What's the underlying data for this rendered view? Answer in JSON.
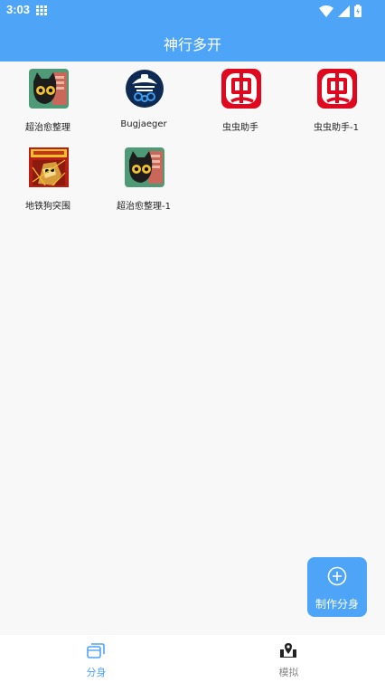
{
  "status_bar": {
    "time": "3:03"
  },
  "app_bar": {
    "title": "神行多开"
  },
  "apps": [
    {
      "label": "超治愈整理",
      "icon": "cat-app-icon"
    },
    {
      "label": "Bugjaeger",
      "icon": "bugjaeger-icon"
    },
    {
      "label": "虫虫助手",
      "icon": "chongchong-icon"
    },
    {
      "label": "虫虫助手-1",
      "icon": "chongchong-icon"
    },
    {
      "label": "地铁狗突围",
      "icon": "subway-dog-icon"
    },
    {
      "label": "超治愈整理-1",
      "icon": "cat-app-icon"
    }
  ],
  "fab": {
    "label": "制作分身",
    "icon": "plus-circle-icon"
  },
  "bottom_nav": {
    "items": [
      {
        "label": "分身",
        "icon": "clones-icon",
        "active": true
      },
      {
        "label": "模拟",
        "icon": "location-tray-icon",
        "active": false
      }
    ]
  },
  "colors": {
    "primary": "#4ea4f6",
    "background": "#f8f8f8",
    "chongchong_red": "#e0081e"
  }
}
